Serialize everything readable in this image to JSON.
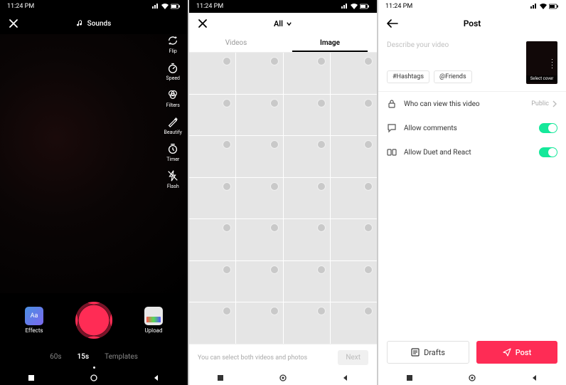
{
  "status": {
    "time": "11:24 PM"
  },
  "panel1": {
    "sounds_label": "Sounds",
    "tools": {
      "flip": "Flip",
      "speed": "Speed",
      "filters": "Filters",
      "beautify": "Beautify",
      "timer": "Timer",
      "flash": "Flash"
    },
    "effects_label": "Effects",
    "upload_label": "Upload",
    "modes": {
      "m60": "60s",
      "m15": "15s",
      "templates": "Templates"
    }
  },
  "panel2": {
    "album": "All",
    "tabs": {
      "videos": "Videos",
      "image": "Image"
    },
    "hint": "You can select both videos and photos",
    "next": "Next"
  },
  "panel3": {
    "title": "Post",
    "desc_placeholder": "Describe your video",
    "chips": {
      "hashtags": "#Hashtags",
      "friends": "@Friends"
    },
    "cover_label": "Select cover",
    "options": {
      "privacy_label": "Who can view this video",
      "privacy_value": "Public",
      "comments_label": "Allow comments",
      "duet_label": "Allow Duet and React"
    },
    "drafts_label": "Drafts",
    "post_label": "Post"
  }
}
